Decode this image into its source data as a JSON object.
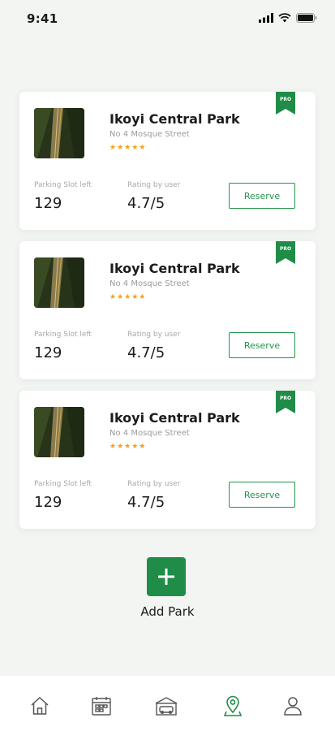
{
  "status": {
    "time": "9:41"
  },
  "parks": [
    {
      "title": "Ikoyi Central Park",
      "address": "No 4 Mosque Street",
      "stars": "★★★★★",
      "slot_label": "Parking Slot left",
      "slot_value": "129",
      "rating_label": "Rating by user",
      "rating_value": "4.7/5",
      "reserve_label": "Reserve",
      "badge": "PRO"
    },
    {
      "title": "Ikoyi Central Park",
      "address": "No 4 Mosque Street",
      "stars": "★★★★★",
      "slot_label": "Parking Slot left",
      "slot_value": "129",
      "rating_label": "Rating by user",
      "rating_value": "4.7/5",
      "reserve_label": "Reserve",
      "badge": "PRO"
    },
    {
      "title": "Ikoyi Central Park",
      "address": "No 4 Mosque Street",
      "stars": "★★★★★",
      "slot_label": "Parking Slot left",
      "slot_value": "129",
      "rating_label": "Rating by user",
      "rating_value": "4.7/5",
      "reserve_label": "Reserve",
      "badge": "PRO"
    }
  ],
  "add": {
    "icon": "plus-icon",
    "label": "Add Park"
  },
  "tabs": [
    {
      "icon": "home-icon",
      "active": false
    },
    {
      "icon": "calendar-icon",
      "active": false
    },
    {
      "icon": "parking-icon",
      "active": false
    },
    {
      "icon": "location-pin-icon",
      "active": true
    },
    {
      "icon": "user-icon",
      "active": false
    }
  ],
  "colors": {
    "accent": "#1f8c47",
    "star": "#f2a218",
    "background": "#f2f5f1"
  }
}
